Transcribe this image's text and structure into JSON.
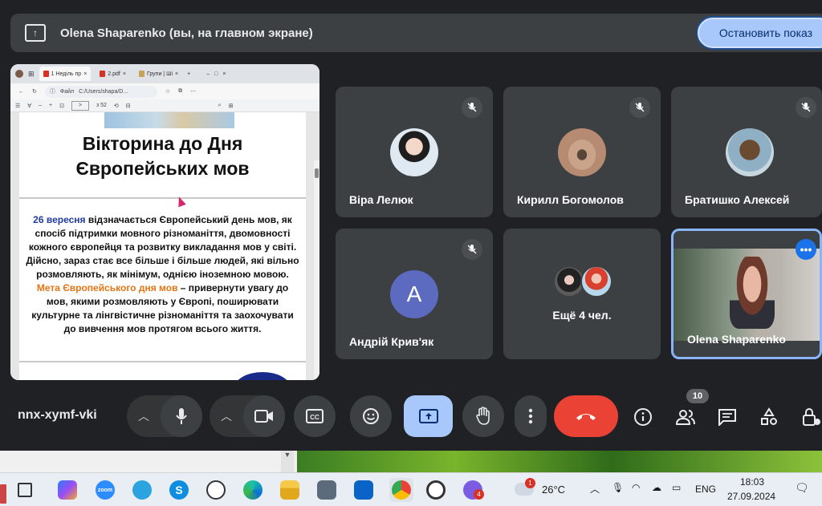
{
  "banner": {
    "presenter_text": "Olena Shaparenko (вы, на главном экране)",
    "stop_button": "Остановить показ"
  },
  "browser": {
    "tabs": [
      "1 Неділь пр",
      "2.pdf",
      "Групи | Ші"
    ],
    "address_prefix": "Файл",
    "address": "C:/Users/shapa/D...",
    "page_input": ">",
    "page_total": "з 52"
  },
  "pdf": {
    "title_line1": "Вікторина до Дня",
    "title_line2": "Європейських мов",
    "para1_highlight": "26 вересня",
    "para1_rest": " відзначається Європейський день мов, як спосіб підтримки мовного різноманіття, двомовності кожного європейця та розвитку викладання мов у світі. Дійсно, зараз стає все більше і більше людей, які вільно розмовляють, як мінімум, однією іноземною мовою.",
    "para2_highlight": "Мета Європейського дня мов",
    "para2_rest": " – привернути увагу до мов, якими розмовляють у Європі, поширювати культурне та лінгвістичне різноманіття та заохочувати до вивчення мов протягом всього життя."
  },
  "participants": [
    {
      "name": "Віра Лелюк"
    },
    {
      "name": "Кирилл Богомолов"
    },
    {
      "name": "Братишко Алексей"
    },
    {
      "name": "Андрій Крив'як",
      "initial": "A"
    },
    {
      "name": "Ещё 4 чел."
    },
    {
      "name": "Olena Shaparenko"
    }
  ],
  "controls": {
    "meeting_code": "nnx-xymf-vki",
    "participant_count": "10"
  },
  "taskbar": {
    "weather_temp": "26°C",
    "weather_badge": "1",
    "viber_badge": "4",
    "language": "ENG",
    "time": "18:03",
    "date": "27.09.2024"
  },
  "colors": {
    "background": "#202124",
    "tile": "#3c4043",
    "accent_blue": "#a8c7fa",
    "end_call_red": "#ea4335"
  }
}
